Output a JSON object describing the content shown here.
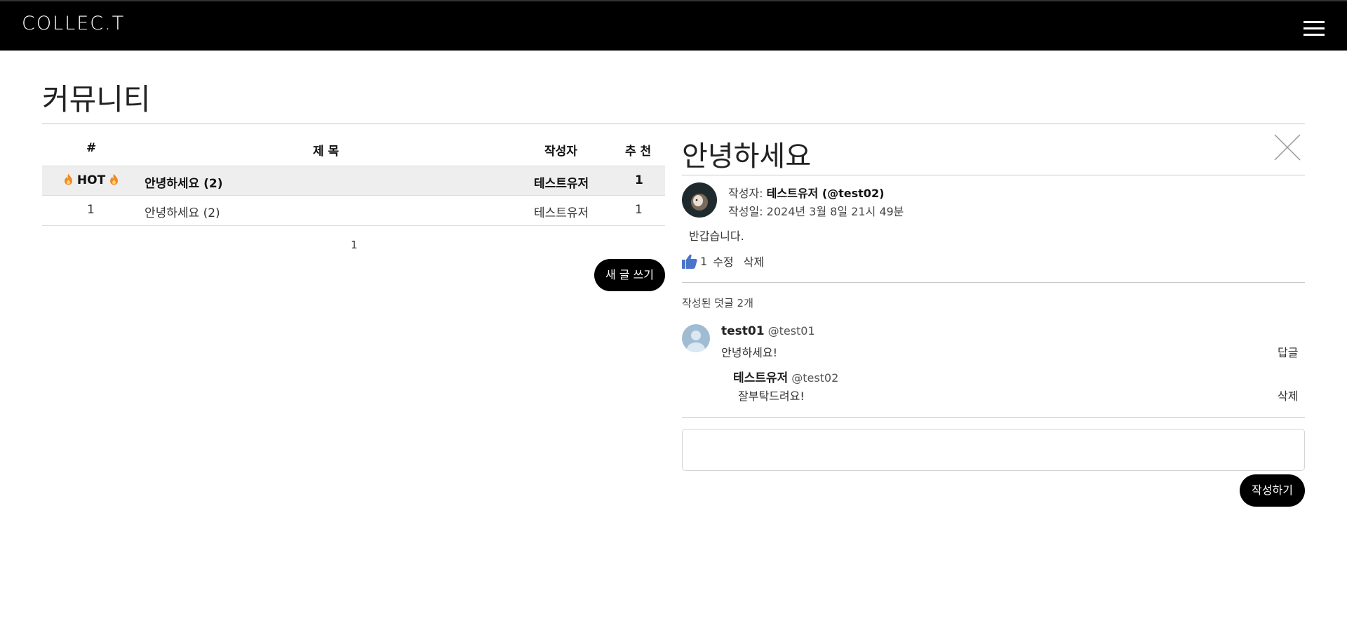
{
  "header": {
    "logo": "COLLEC.T",
    "menu_icon": "hamburger-menu-icon"
  },
  "page": {
    "title": "커뮤니티"
  },
  "board": {
    "columns": [
      "#",
      "제 목",
      "작성자",
      "추 천"
    ],
    "hot_row": {
      "badge": "HOT",
      "title": "안녕하세요 (2)",
      "author": "테스트유저",
      "likes": "1"
    },
    "rows": [
      {
        "no": "1",
        "title": "안녕하세요 (2)",
        "author": "테스트유저",
        "likes": "1"
      }
    ],
    "pagination": "1",
    "new_post_label": "새 글 쓰기"
  },
  "post": {
    "title": "안녕하세요",
    "author_label": "작성자:",
    "author": "테스트유저 (@test02)",
    "date_label": "작성일:",
    "date": "2024년 3월 8일 21시 49분",
    "body": "반갑습니다.",
    "likes": "1",
    "edit_label": "수정",
    "delete_label": "삭제"
  },
  "comments": {
    "count_label": "작성된 덧글 2개",
    "items": [
      {
        "name": "test01",
        "handle": "@test01",
        "text": "안녕하세요!",
        "action": "답글"
      }
    ],
    "replies": [
      {
        "name": "테스트유저",
        "handle": "@test02",
        "text": "잘부탁드려요!",
        "action": "삭제"
      }
    ],
    "input_placeholder": "",
    "submit_label": "작성하기"
  },
  "colors": {
    "topbar": "#000000",
    "accent_button": "#000000",
    "hot_row_bg": "#eeeeee",
    "like_icon": "#4a74c9",
    "flame": "#f08a24"
  }
}
